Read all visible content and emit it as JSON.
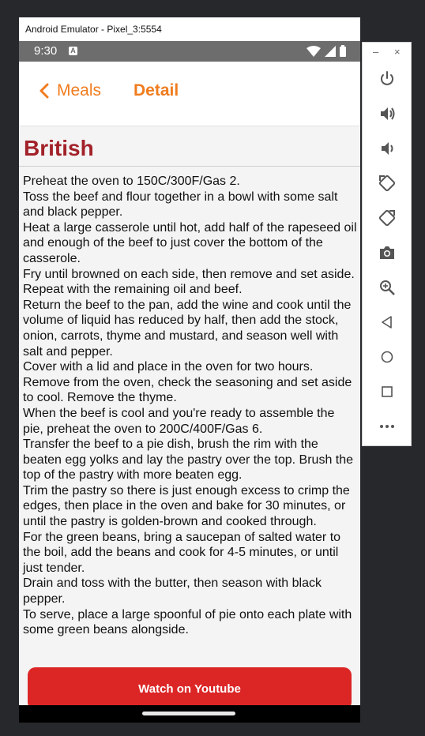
{
  "window": {
    "title": "Android Emulator - Pixel_3:5554"
  },
  "status_bar": {
    "time": "9:30",
    "notification_icon": "a-badge-icon",
    "icons": [
      "wifi-icon",
      "signal-icon",
      "battery-icon"
    ]
  },
  "app_bar": {
    "back_label": "Meals",
    "title": "Detail"
  },
  "meal": {
    "name": "British",
    "instructions": "Preheat the oven to 150C/300F/Gas 2.\nToss the beef and flour together in a bowl with some salt and black pepper.\nHeat a large casserole until hot, add half of the rapeseed oil and enough of the beef to just cover the bottom of the casserole.\nFry until browned on each side, then remove and set aside. Repeat with the remaining oil and beef.\nReturn the beef to the pan, add the wine and cook until the volume of liquid has reduced by half, then add the stock, onion, carrots, thyme and mustard, and season well with salt and pepper.\nCover with a lid and place in the oven for two hours.\nRemove from the oven, check the seasoning and set aside to cool. Remove the thyme.\nWhen the beef is cool and you're ready to assemble the pie, preheat the oven to 200C/400F/Gas 6.\nTransfer the beef to a pie dish, brush the rim with the beaten egg yolks and lay the pastry over the top. Brush the top of the pastry with more beaten egg.\nTrim the pastry so there is just enough excess to crimp the edges, then place in the oven and bake for 30 minutes, or until the pastry is golden-brown and cooked through.\nFor the green beans, bring a saucepan of salted water to the boil, add the beans and cook for 4-5 minutes, or until just tender.\nDrain and toss with the butter, then season with black pepper.\nTo serve, place a large spoonful of pie onto each plate with some green beans alongside."
  },
  "actions": {
    "watch_label": "Watch on Youtube"
  },
  "emulator_panel": {
    "minimize_label": "–",
    "close_label": "×",
    "tools": [
      "power-icon",
      "volume-up-icon",
      "volume-down-icon",
      "rotate-left-icon",
      "rotate-right-icon",
      "camera-icon",
      "zoom-icon",
      "back-icon",
      "home-icon",
      "overview-icon",
      "more-icon"
    ]
  },
  "colors": {
    "accent": "#f07c1e",
    "title": "#a2222a",
    "button": "#dc2626",
    "status_bar": "#6d6d6d"
  }
}
